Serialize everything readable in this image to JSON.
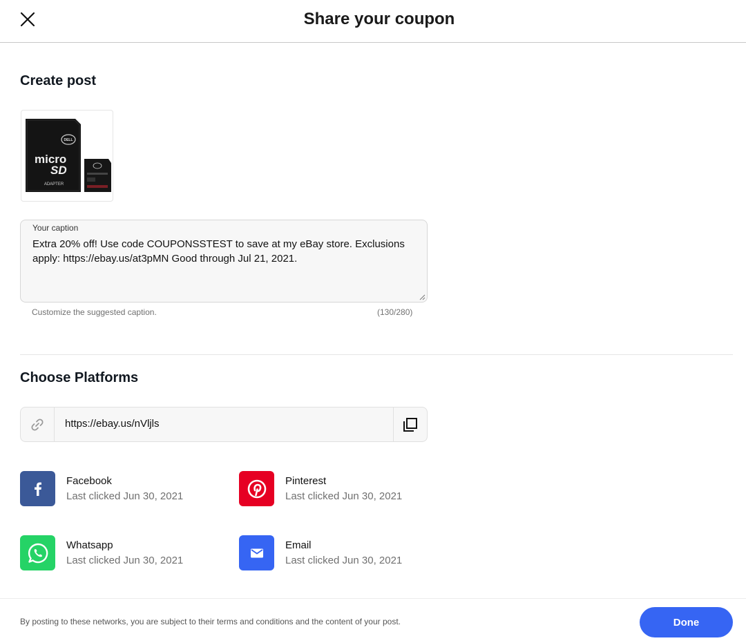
{
  "header": {
    "title": "Share your coupon",
    "close_icon": "close-icon"
  },
  "create_post": {
    "title": "Create post",
    "image_alt": "microSD card with adapter",
    "card_text": {
      "brand": "DELL",
      "micro": "micro",
      "sd": "SD",
      "adapter": "ADAPTER"
    },
    "caption": {
      "label": "Your caption",
      "value": "Extra 20% off! Use code COUPONSSTEST to save at my eBay store. Exclusions apply: https://ebay.us/at3pMN Good through Jul 21, 2021.",
      "helper": "Customize the suggested caption.",
      "counter": "(130/280)"
    }
  },
  "platforms": {
    "title": "Choose Platforms",
    "link_url": "https://ebay.us/nVljls",
    "link_icon": "link-icon",
    "copy_icon": "copy-icon",
    "items": [
      {
        "name": "Facebook",
        "sub": "Last clicked Jun 30, 2021",
        "color": "#3b5998",
        "icon": "facebook-icon"
      },
      {
        "name": "Pinterest",
        "sub": "Last clicked Jun 30, 2021",
        "color": "#e60023",
        "icon": "pinterest-icon"
      },
      {
        "name": "Whatsapp",
        "sub": "Last clicked Jun 30, 2021",
        "color": "#25d366",
        "icon": "whatsapp-icon"
      },
      {
        "name": "Email",
        "sub": "Last clicked Jun 30, 2021",
        "color": "#3665f3",
        "icon": "email-icon"
      }
    ]
  },
  "footer": {
    "note": "By posting to these networks, you are subject to their terms and conditions and the content of your post.",
    "done_label": "Done",
    "done_color": "#3665f3"
  }
}
